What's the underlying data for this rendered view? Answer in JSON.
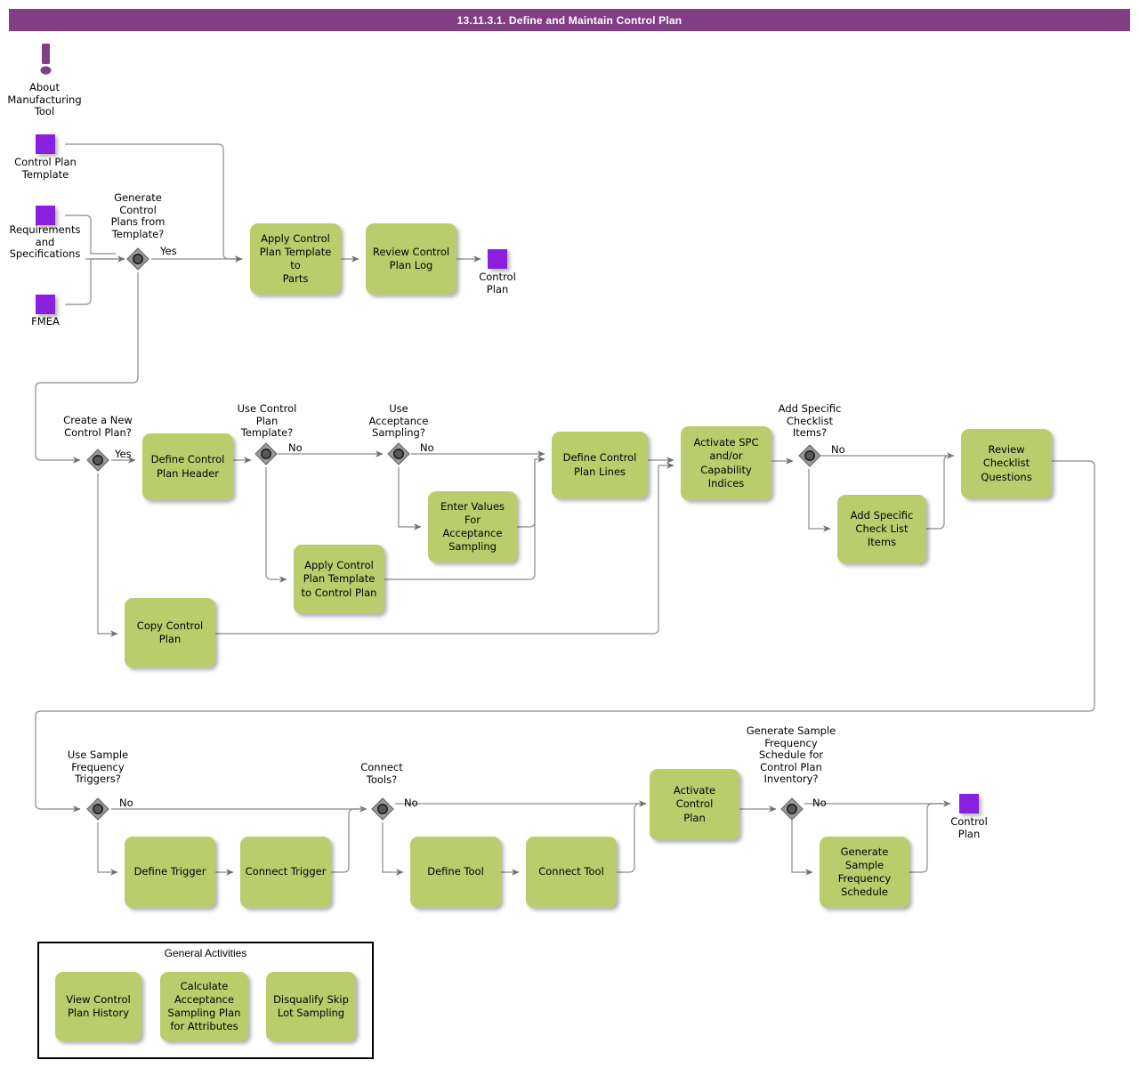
{
  "header": {
    "title": "13.11.3.1. Define and Maintain Control Plan"
  },
  "note": {
    "icon": "exclamation-note-icon",
    "label": "About\nManufacturing\nTool"
  },
  "data_objects": [
    {
      "id": "control-plan-template",
      "label": "Control Plan\nTemplate"
    },
    {
      "id": "requirements-and-specifications",
      "label": "Requirements\nand\nSpecifications"
    },
    {
      "id": "fmea",
      "label": "FMEA"
    },
    {
      "id": "control-plan-out-top",
      "label": "Control\nPlan"
    },
    {
      "id": "control-plan-out-bottom",
      "label": "Control\nPlan"
    }
  ],
  "gateways": [
    {
      "id": "generate-control-plans-from-template",
      "caption": "Generate\nControl\nPlans from\nTemplate?",
      "branch": "Yes"
    },
    {
      "id": "create-a-new-control-plan",
      "caption": "Create a New\nControl Plan?",
      "branch": "Yes"
    },
    {
      "id": "use-control-plan-template",
      "caption": "Use Control\nPlan\nTemplate?",
      "branch": "No"
    },
    {
      "id": "use-acceptance-sampling",
      "caption": "Use\nAcceptance\nSampling?",
      "branch": "No"
    },
    {
      "id": "add-specific-checklist-items",
      "caption": "Add Specific\nChecklist\nItems?",
      "branch": "No"
    },
    {
      "id": "use-sample-frequency-triggers",
      "caption": "Use Sample\nFrequency\nTriggers?",
      "branch": "No"
    },
    {
      "id": "connect-tools",
      "caption": "Connect\nTools?",
      "branch": "No"
    },
    {
      "id": "generate-sample-frequency-schedule-for-control-plan-inventory",
      "caption": "Generate Sample\nFrequency\nSchedule for\nControl Plan\nInventory?",
      "branch": "No"
    }
  ],
  "tasks": [
    {
      "id": "apply-control-plan-template-to-parts",
      "label": "Apply Control\nPlan Template to\nParts"
    },
    {
      "id": "review-control-plan-log",
      "label": "Review Control\nPlan Log"
    },
    {
      "id": "define-control-plan-header",
      "label": "Define Control\nPlan Header"
    },
    {
      "id": "enter-values-for-acceptance-sampling",
      "label": "Enter Values For\nAcceptance\nSampling"
    },
    {
      "id": "define-control-plan-lines",
      "label": "Define Control\nPlan Lines"
    },
    {
      "id": "activate-spc-andor-capability-indices",
      "label": "Activate SPC\nand/or\nCapability\nIndices"
    },
    {
      "id": "add-specific-check-list-items",
      "label": "Add Specific\nCheck List\nItems"
    },
    {
      "id": "review-checklist-questions",
      "label": "Review\nChecklist\nQuestions"
    },
    {
      "id": "apply-control-plan-template-to-control-plan",
      "label": "Apply Control\nPlan Template\nto Control Plan"
    },
    {
      "id": "copy-control-plan",
      "label": "Copy Control\nPlan"
    },
    {
      "id": "define-trigger",
      "label": "Define Trigger"
    },
    {
      "id": "connect-trigger",
      "label": "Connect Trigger"
    },
    {
      "id": "define-tool",
      "label": "Define Tool"
    },
    {
      "id": "connect-tool",
      "label": "Connect Tool"
    },
    {
      "id": "activate-control-plan",
      "label": "Activate Control\nPlan"
    },
    {
      "id": "generate-sample-frequency-schedule",
      "label": "Generate\nSample\nFrequency\nSchedule"
    }
  ],
  "general_activities": {
    "title": "General Activities",
    "items": [
      {
        "id": "view-control-plan-history",
        "label": "View Control\nPlan History"
      },
      {
        "id": "calculate-acceptance-sampling-plan-for-attributes",
        "label": "Calculate\nAcceptance\nSampling Plan\nfor Attributes"
      },
      {
        "id": "disqualify-skip-lot-sampling",
        "label": "Disqualify Skip\nLot Sampling"
      }
    ]
  },
  "colors": {
    "title_bar": "#823e85",
    "task_fill": "#b9cd6d",
    "data_object_fill": "#8a1fe0",
    "gateway_fill": "#9a9a9a",
    "connector": "#7a7a7a",
    "note_accent": "#823e85"
  }
}
